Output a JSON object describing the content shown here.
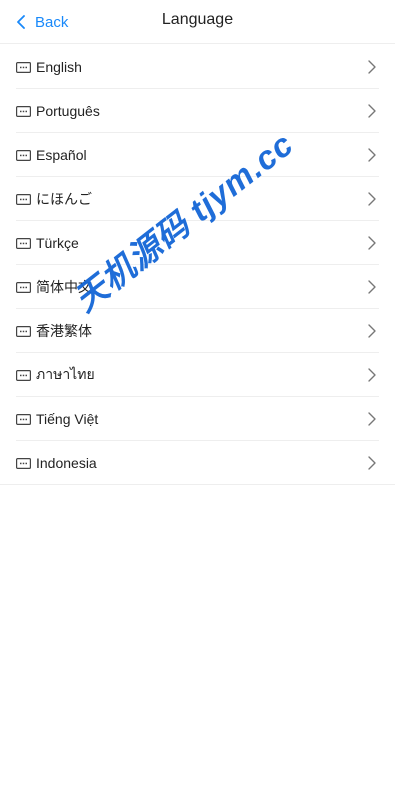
{
  "header": {
    "back_label": "Back",
    "title": "Language"
  },
  "languages": [
    {
      "label": "English"
    },
    {
      "label": "Português"
    },
    {
      "label": "Español"
    },
    {
      "label": "にほんご"
    },
    {
      "label": "Türkçe"
    },
    {
      "label": "简体中文"
    },
    {
      "label": "香港繁体"
    },
    {
      "label": "ภาษาไทย"
    },
    {
      "label": "Tiếng Việt"
    },
    {
      "label": "Indonesia"
    }
  ],
  "icons": {
    "back": "chevron-left-icon",
    "row_leading": "keyboard-icon",
    "row_trailing": "chevron-right-icon"
  },
  "watermark": "天机源码 tjym.cc",
  "colors": {
    "accent": "#1989fa",
    "watermark": "#1466d6"
  }
}
